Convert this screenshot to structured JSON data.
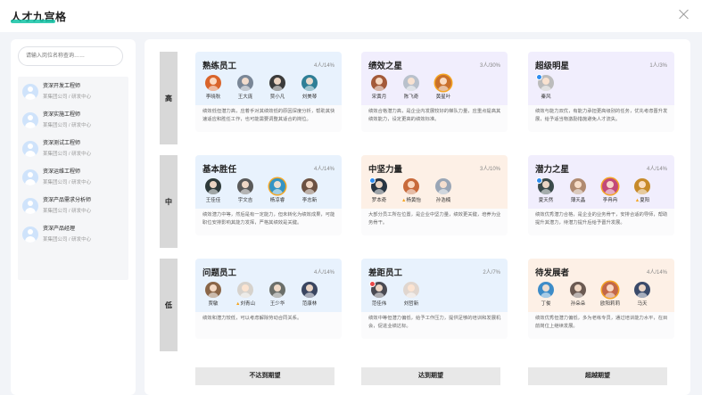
{
  "header": {
    "title": "人才九宫格"
  },
  "sidebar": {
    "search_placeholder": "请输入岗位名称查询……",
    "positions": [
      {
        "name": "资深开发工程师",
        "org": "某集团公司 / 研发中心"
      },
      {
        "name": "资深实施工程师",
        "org": "某集团公司 / 研发中心"
      },
      {
        "name": "资深测试工程师",
        "org": "某集团公司 / 研发中心"
      },
      {
        "name": "资深运维工程师",
        "org": "某集团公司 / 研发中心"
      },
      {
        "name": "资深产品需求分析师",
        "org": "某集团公司 / 研发中心"
      },
      {
        "name": "资深产品经理",
        "org": "某集团公司 / 研发中心"
      }
    ]
  },
  "grid": {
    "row_labels": [
      "高",
      "中",
      "低"
    ],
    "col_labels": [
      "不达到期望",
      "达到期望",
      "超越期望"
    ],
    "cells": [
      {
        "title": "熟练员工",
        "count": "4人/14%",
        "bg": "#e8f2fd",
        "employees": [
          {
            "name": "李晓秋",
            "color": "#d9642b"
          },
          {
            "name": "王大庞",
            "color": "#7a8797"
          },
          {
            "name": "贾小凡",
            "color": "#3b3b3b"
          },
          {
            "name": "刘美琴",
            "color": "#2f7f96"
          }
        ],
        "desc": "绩效低但潜力高，应着手对其绩效低的原因深度分析，帮助其快速适应和胜任工作，也可能需要调整其适合的岗位。"
      },
      {
        "title": "绩效之星",
        "count": "3人/30%",
        "bg": "#f1eefd",
        "employees": [
          {
            "name": "宋黄月",
            "color": "#a35a3a"
          },
          {
            "name": "陈飞奇",
            "color": "#b9c1cc"
          },
          {
            "name": "黄星叶",
            "color": "#c9702c",
            "ring": true
          }
        ],
        "desc": "绩效合格潜力高，是企业内发展较好的梯队力量，应重点提高其绩效能力，设定更高的绩效标准。"
      },
      {
        "title": "超级明星",
        "count": "1人/3%",
        "bg": "#f1eefd",
        "employees": [
          {
            "name": "秦风",
            "color": "#bcbcbc",
            "badge": "blue"
          }
        ],
        "desc": "绩效与能力双优，有能力承担更高级别的任务，优先考虑晋升发展，给予适当物激励措施避免人才流失。"
      },
      {
        "title": "基本胜任",
        "count": "4人/14%",
        "bg": "#e8f2fd",
        "employees": [
          {
            "name": "王佳佳",
            "color": "#2e3a3a"
          },
          {
            "name": "宇文吉",
            "color": "#5a5a5a"
          },
          {
            "name": "杨凉睿",
            "color": "#3494c4",
            "ring": true
          },
          {
            "name": "李志新",
            "color": "#6c5242"
          }
        ],
        "desc": "绩效潜力中等，然后是有一定能力，但未转化为绩效成果，可能职位安排影响其能力发挥，严格其绩效是关键。"
      },
      {
        "title": "中坚力量",
        "count": "3人/10%",
        "bg": "#fdf0e6",
        "employees": [
          {
            "name": "罗本奇",
            "color": "#283542",
            "badge": "blue"
          },
          {
            "name": "杨黄怡",
            "color": "#c86a3b",
            "warn": true
          },
          {
            "name": "孙浩楠",
            "color": "#9aa6b6"
          }
        ],
        "desc": "大部分员工所在位置，是企业中坚力量，绩效更关键，培养为业务骨干。"
      },
      {
        "title": "潜力之星",
        "count": "4人/14%",
        "bg": "#f1eefd",
        "employees": [
          {
            "name": "夏天然",
            "color": "#3b4b4b",
            "badge": "blue"
          },
          {
            "name": "薄天晶",
            "color": "#b08a70"
          },
          {
            "name": "李冉冉",
            "color": "#c24a7a",
            "ring": true
          },
          {
            "name": "夏阳",
            "color": "#c78a2a",
            "warn": true
          }
        ],
        "desc": "绩效优秀潜力合格，是企业的业务骨干，安排合适的导师，帮助提升其潜力，待潜力提升后给予晋升发展。"
      },
      {
        "title": "问题员工",
        "count": "4人/14%",
        "bg": "#e8f2fd",
        "employees": [
          {
            "name": "贾敏",
            "color": "#8a6648"
          },
          {
            "name": "刘青山",
            "color": "#d6d2cc",
            "warn": true
          },
          {
            "name": "王少华",
            "color": "#6b6f6a"
          },
          {
            "name": "范康林",
            "color": "#3a4660"
          }
        ],
        "desc": "绩效和潜力较低，可以考虑解除劳动合同关系。"
      },
      {
        "title": "差距员工",
        "count": "2人/7%",
        "bg": "#e8f2fd",
        "employees": [
          {
            "name": "范佳伟",
            "color": "#4a4a52",
            "badge": "red"
          },
          {
            "name": "刘哲新",
            "color": "#e0d6cf"
          }
        ],
        "desc": "绩效中等但潜力偏低，给予工作压力，提供足够的培训和发展机会，促进业绩达标。"
      },
      {
        "title": "待发展者",
        "count": "4人/14%",
        "bg": "#fdf0e6",
        "employees": [
          {
            "name": "丁俊",
            "color": "#3d8cc8"
          },
          {
            "name": "孙朵朵",
            "color": "#6b5a52"
          },
          {
            "name": "欧阳莉莉",
            "color": "#c2684a",
            "ring": true
          },
          {
            "name": "马天",
            "color": "#3a4a6a"
          }
        ],
        "desc": "绩效优秀但潜力偏低，多为老练专员，通过培训能力水平，在目前岗位上继续发展。"
      }
    ]
  }
}
